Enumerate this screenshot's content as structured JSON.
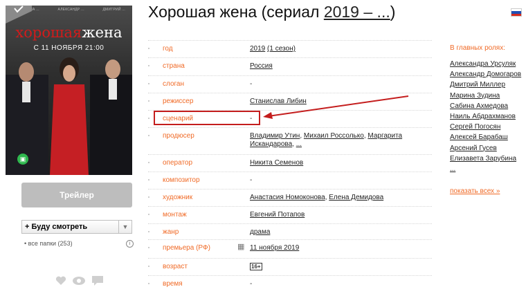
{
  "poster": {
    "cast_line": [
      "КРИСТИНА ...",
      "АЛЕКСАНДР ...",
      "ДМИТРИЙ ..."
    ],
    "title_part1": "хорошая",
    "title_part2": "жена",
    "date_line": "С 11 НОЯБРЯ 21:00",
    "channel_icon": "ntv-channel-icon"
  },
  "trailer_button": "Трейлер",
  "watch_select": {
    "label": "+ Буду смотреть",
    "arrow": "▼"
  },
  "folders_text": "• все папки (253)",
  "page_title": {
    "text": "Хорошая жена (сериал ",
    "year_link": "2019 – ...",
    "close": ")"
  },
  "language_flag": {
    "colors": [
      "#ffffff",
      "#1f4fb4",
      "#d52b1e"
    ]
  },
  "info_rows": [
    {
      "label": "год",
      "values": [
        {
          "text": "2019",
          "link": true
        },
        {
          "text": " ",
          "link": false
        },
        {
          "text": "(1 сезон)",
          "link": true
        }
      ]
    },
    {
      "label": "страна",
      "values": [
        {
          "text": "Россия",
          "link": true
        }
      ]
    },
    {
      "label": "слоган",
      "values": [
        {
          "text": "-",
          "link": false
        }
      ]
    },
    {
      "label": "режиссер",
      "values": [
        {
          "text": "Станислав Либин",
          "link": true
        }
      ]
    },
    {
      "label": "сценарий",
      "values": [
        {
          "text": "-",
          "link": false
        }
      ]
    },
    {
      "label": "продюсер",
      "values": [
        {
          "text": "Владимир Утин",
          "link": true
        },
        {
          "text": ", ",
          "link": false
        },
        {
          "text": "Михаил Россолько",
          "link": true
        },
        {
          "text": ", ",
          "link": false
        },
        {
          "text": "Маргарита Искандарова",
          "link": true
        },
        {
          "text": ", ",
          "link": false
        },
        {
          "text": "...",
          "link": true
        }
      ]
    },
    {
      "label": "оператор",
      "values": [
        {
          "text": "Никита Семенов",
          "link": true
        }
      ]
    },
    {
      "label": "композитор",
      "values": [
        {
          "text": "-",
          "link": false
        }
      ]
    },
    {
      "label": "художник",
      "values": [
        {
          "text": "Анастасия Номоконова",
          "link": true
        },
        {
          "text": ", ",
          "link": false
        },
        {
          "text": "Елена Демидова",
          "link": true
        }
      ]
    },
    {
      "label": "монтаж",
      "values": [
        {
          "text": "Евгений Потапов",
          "link": true
        }
      ]
    },
    {
      "label": "жанр",
      "values": [
        {
          "text": "драма",
          "link": true
        }
      ]
    },
    {
      "label": "премьера (РФ)",
      "values": [
        {
          "text": "11 ноября 2019",
          "link": true
        }
      ]
    },
    {
      "label": "возраст",
      "values": [
        {
          "text": "16+",
          "link": false
        }
      ]
    },
    {
      "label": "время",
      "values": [
        {
          "text": "-",
          "link": false
        }
      ]
    }
  ],
  "cast": {
    "heading": "В главных ролях:",
    "actors": [
      "Александра Урсуляк",
      "Александр Домогаров",
      "Дмитрий Миллер",
      "Марина Зудина",
      "Сабина Ахмедова",
      "Наиль Абдрахманов",
      "Сергей Погосян",
      "Алексей Барабаш",
      "Арсений Гусев",
      "Елизавета Зарубина",
      "..."
    ],
    "show_all": "показать всех »"
  },
  "colors": {
    "label_orange": "#f06a26",
    "highlight_red": "#c41d1d"
  }
}
